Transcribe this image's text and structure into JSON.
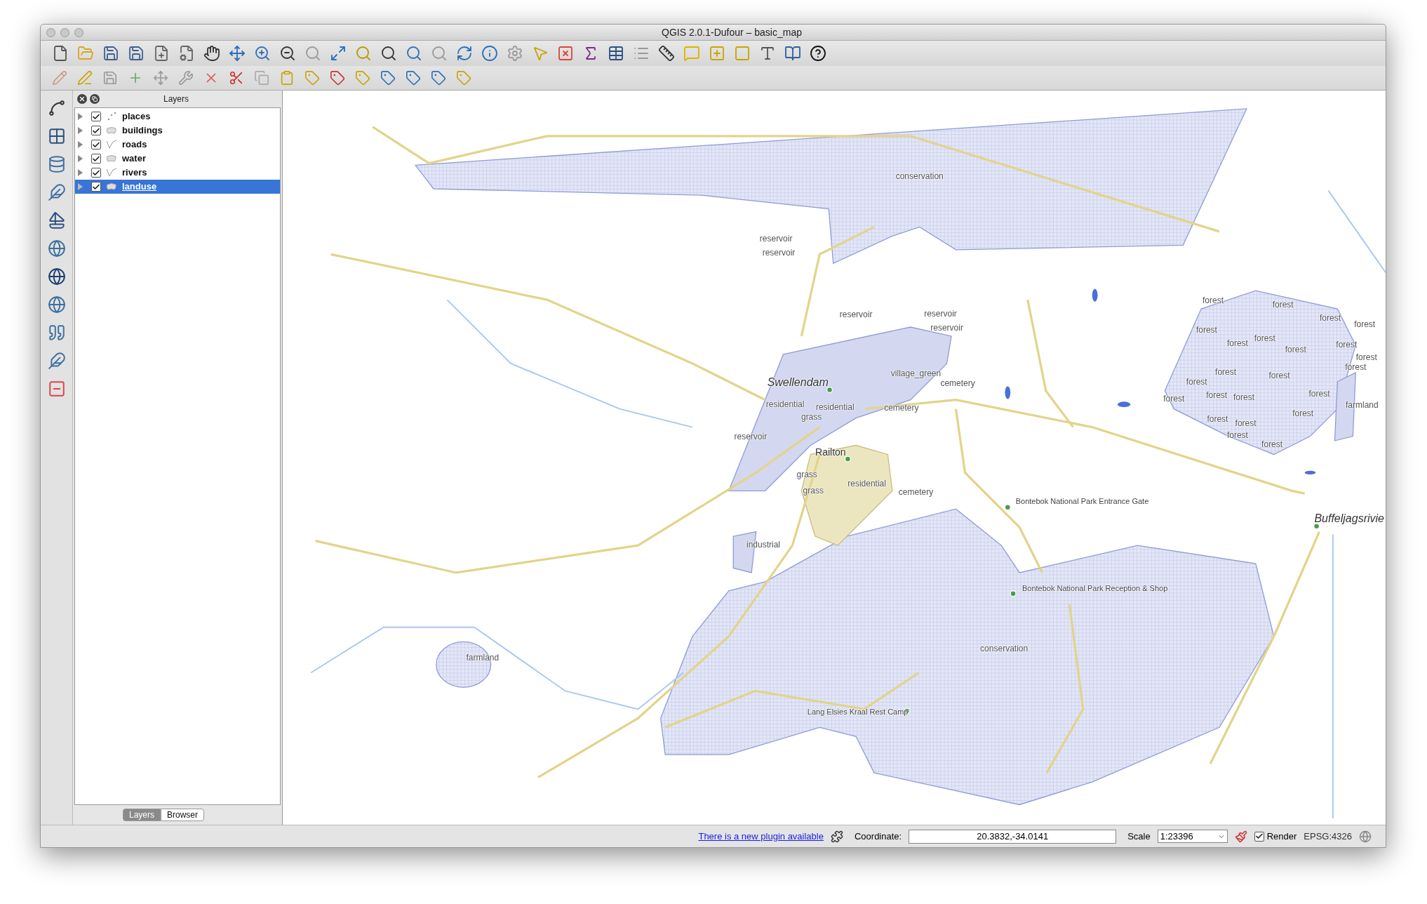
{
  "window": {
    "title": "QGIS 2.0.1-Dufour – basic_map"
  },
  "layers_panel": {
    "title": "Layers",
    "layers": [
      {
        "name": "places",
        "kind": "point",
        "checked": true,
        "expanded": false,
        "selected": false
      },
      {
        "name": "buildings",
        "kind": "polygon",
        "checked": true,
        "expanded": false,
        "selected": false
      },
      {
        "name": "roads",
        "kind": "line",
        "checked": true,
        "expanded": false,
        "selected": false
      },
      {
        "name": "water",
        "kind": "polygon",
        "checked": true,
        "expanded": false,
        "selected": false
      },
      {
        "name": "rivers",
        "kind": "line",
        "checked": true,
        "expanded": false,
        "selected": false
      },
      {
        "name": "landuse",
        "kind": "polygon",
        "checked": true,
        "expanded": false,
        "selected": true
      }
    ],
    "tabs": [
      {
        "label": "Layers",
        "selected": true
      },
      {
        "label": "Browser",
        "selected": false
      }
    ]
  },
  "map": {
    "labels": [
      {
        "text": "conservation",
        "kind": "landuse"
      },
      {
        "text": "reservoir",
        "kind": "landuse"
      },
      {
        "text": "reservoir",
        "kind": "landuse"
      },
      {
        "text": "reservoir",
        "kind": "landuse"
      },
      {
        "text": "reservoir",
        "kind": "landuse"
      },
      {
        "text": "reservoir",
        "kind": "landuse"
      },
      {
        "text": "Swellendam",
        "kind": "town"
      },
      {
        "text": "village_green",
        "kind": "landuse"
      },
      {
        "text": "cemetery",
        "kind": "landuse"
      },
      {
        "text": "residential",
        "kind": "landuse"
      },
      {
        "text": "residential",
        "kind": "landuse"
      },
      {
        "text": "grass",
        "kind": "landuse"
      },
      {
        "text": "cemetery",
        "kind": "landuse"
      },
      {
        "text": "reservoir",
        "kind": "landuse"
      },
      {
        "text": "Railton",
        "kind": "village"
      },
      {
        "text": "grass",
        "kind": "landuse"
      },
      {
        "text": "residential",
        "kind": "landuse"
      },
      {
        "text": "grass",
        "kind": "landuse"
      },
      {
        "text": "cemetery",
        "kind": "landuse"
      },
      {
        "text": "Bontebok National Park Entrance Gate",
        "kind": "poi"
      },
      {
        "text": "industrial",
        "kind": "landuse"
      },
      {
        "text": "Bontebok National Park Reception & Shop",
        "kind": "poi"
      },
      {
        "text": "conservation",
        "kind": "landuse"
      },
      {
        "text": "farmland",
        "kind": "landuse"
      },
      {
        "text": "Lang Elsies Kraal Rest Camp",
        "kind": "poi"
      },
      {
        "text": "Buffeljagsrivie",
        "kind": "town"
      },
      {
        "text": "farmland",
        "kind": "landuse"
      },
      {
        "text": "forest",
        "kind": "landuse"
      },
      {
        "text": "forest",
        "kind": "landuse"
      },
      {
        "text": "forest",
        "kind": "landuse"
      },
      {
        "text": "forest",
        "kind": "landuse"
      },
      {
        "text": "forest",
        "kind": "landuse"
      },
      {
        "text": "forest",
        "kind": "landuse"
      },
      {
        "text": "forest",
        "kind": "landuse"
      },
      {
        "text": "forest",
        "kind": "landuse"
      },
      {
        "text": "forest",
        "kind": "landuse"
      },
      {
        "text": "forest",
        "kind": "landuse"
      },
      {
        "text": "forest",
        "kind": "landuse"
      },
      {
        "text": "forest",
        "kind": "landuse"
      },
      {
        "text": "forest",
        "kind": "landuse"
      },
      {
        "text": "forest",
        "kind": "landuse"
      },
      {
        "text": "forest",
        "kind": "landuse"
      },
      {
        "text": "forest",
        "kind": "landuse"
      },
      {
        "text": "forest",
        "kind": "landuse"
      },
      {
        "text": "forest",
        "kind": "landuse"
      },
      {
        "text": "forest",
        "kind": "landuse"
      },
      {
        "text": "forest",
        "kind": "landuse"
      },
      {
        "text": "forest",
        "kind": "landuse"
      },
      {
        "text": "forest",
        "kind": "landuse"
      },
      {
        "text": "forest",
        "kind": "landuse"
      }
    ]
  },
  "status_bar": {
    "plugin_link": "There is a new plugin available",
    "coordinate_label": "Coordinate:",
    "coordinate": "20.3832,-34.0141",
    "scale_label": "Scale",
    "scale": "1:23396",
    "render": {
      "label": "Render",
      "checked": true
    },
    "crs": "EPSG:4326"
  }
}
